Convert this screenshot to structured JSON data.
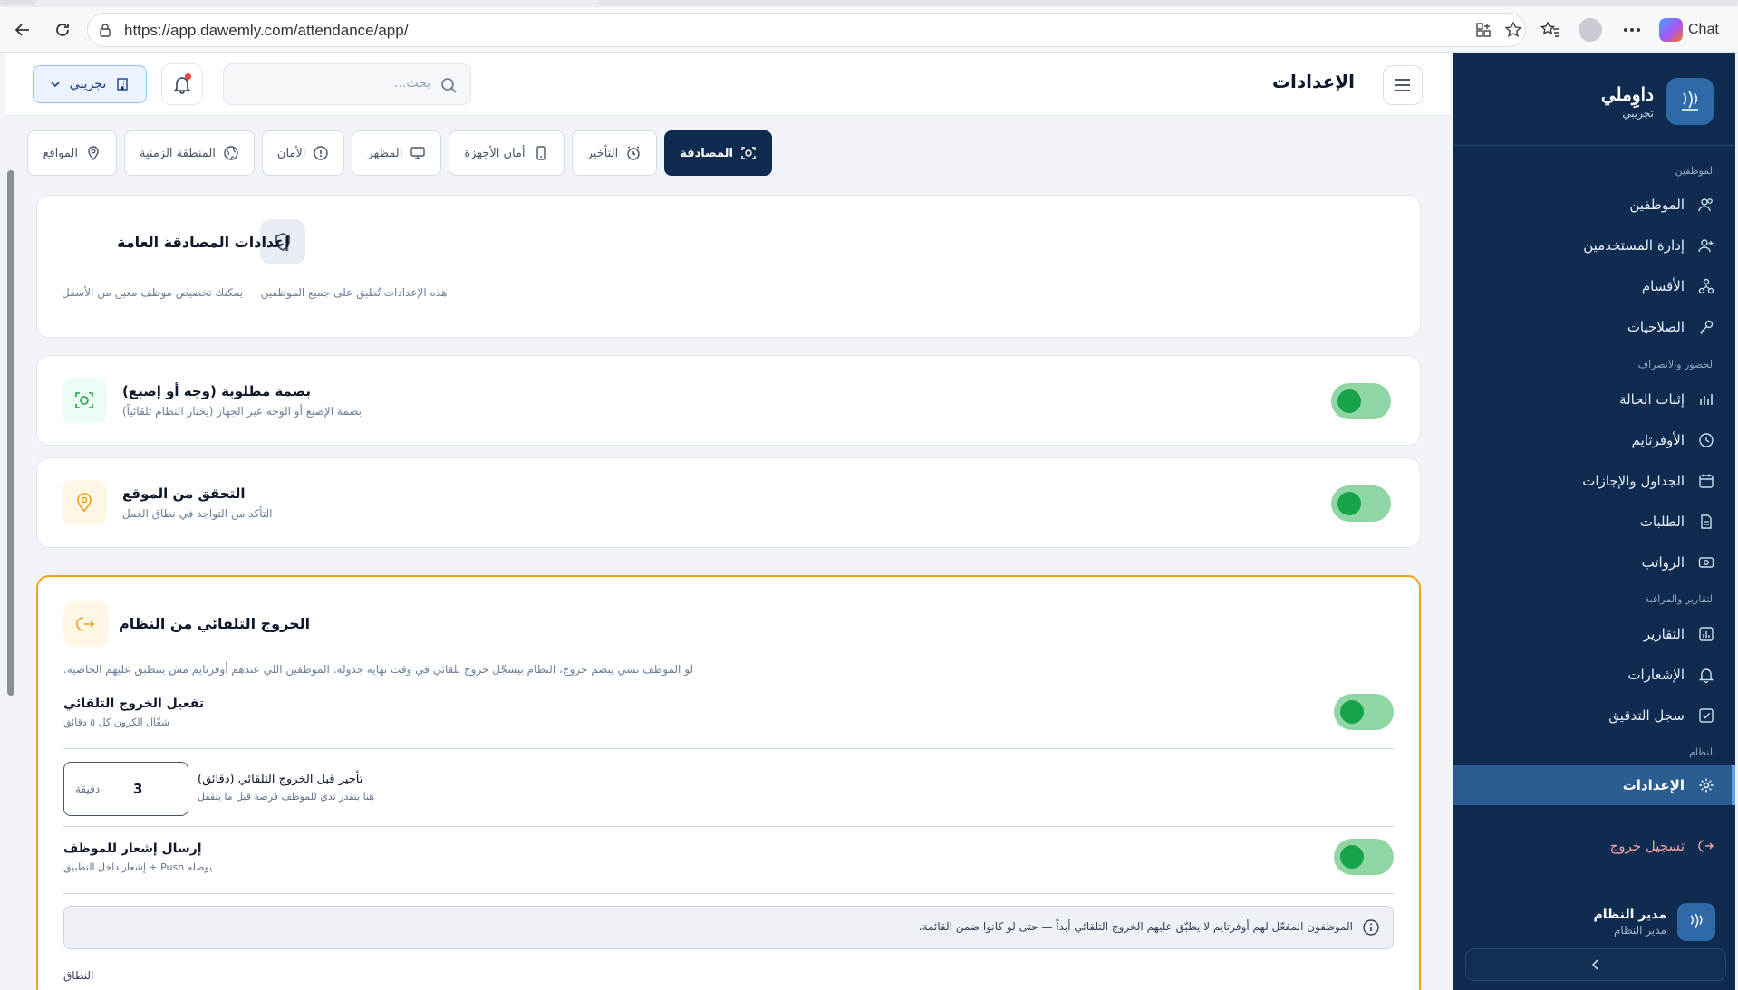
{
  "browser": {
    "url": "https://app.dawemly.com/attendance/app/",
    "chat_label": "Chat"
  },
  "header": {
    "title": "الإعدادات",
    "search_placeholder": "بحث...",
    "company_label": "تجريبي"
  },
  "sidebar": {
    "brand_name": "داوِملي",
    "brand_sub": "تجريبي",
    "sections": {
      "employees": "الموظفين",
      "attendance": "الحضور والانصراف",
      "reports": "التقارير والمراقبة",
      "system": "النظام"
    },
    "items": {
      "employees": "الموظفين",
      "users": "إدارة المستخدمين",
      "departments": "الأقسام",
      "permissions": "الصلاحيات",
      "checkin": "إثبات الحالة",
      "overtime": "الأوفرتايم",
      "schedules": "الجداول والإجازات",
      "requests": "الطلبات",
      "payroll": "الرواتب",
      "reports": "التقارير",
      "notifications": "الإشعارات",
      "audit": "سجل التدقيق",
      "settings": "الإعدادات",
      "logout": "تسجيل خروج"
    },
    "user": {
      "name": "مدير النظام",
      "role": "مدير النظام"
    }
  },
  "tabs": [
    "المصادقة",
    "التأخير",
    "أمان الأجهزة",
    "المظهر",
    "الأمان",
    "المنطقة الزمنية",
    "المواقع"
  ],
  "general_card": {
    "title": "إعدادات المصادقة العامة",
    "desc": "هذه الإعدادات تُطبق على جميع الموظفين — يمكنك تخصيص موظف معين من الأسفل"
  },
  "biometric_card": {
    "title": "بصمة مطلوبة (وجه أو إصبع)",
    "desc": "بصمة الإصبع أو الوجه عبر الجهاز (يختار النظام تلقائياً)",
    "enabled": true
  },
  "location_card": {
    "title": "التحقق من الموقع",
    "desc": "التأكد من التواجد في نطاق العمل",
    "enabled": true
  },
  "autologout_card": {
    "title": "الخروج التلقائي من النظام",
    "desc": "لو الموظف نسي يبصم خروج، النظام بيسجّل خروج تلقائي في وقت نهاية جدوله. الموظفين اللي عندهم أوفرتايم مش بتتطبق عليهم الخاصية.",
    "enable_title": "تفعيل الخروج التلقائي",
    "enable_desc": "شغّال الكرون كل ٥ دقائق",
    "enable_on": true,
    "delay_title": "تأخير قبل الخروج التلقائي (دقائق)",
    "delay_desc": "هنا بتقدر تدي للموظف فرصة قبل ما يتقفل",
    "delay_value": "3",
    "delay_unit": "دقيقة",
    "notify_title": "إرسال إشعار للموظف",
    "notify_desc": "يوصله Push + إشعار داخل التطبيق",
    "notify_on": true,
    "note": "الموظفون المفعّل لهم أوفرتايم لا يطبّق عليهم الخروج التلقائي أبداً — حتى لو كانوا ضمن القائمة.",
    "scope_label": "النطاق"
  },
  "colors": {
    "sidebar_bg": "#0f2b4f",
    "accent": "#0f2b4f",
    "toggle_on": "#16a34a",
    "warning_border": "#f0a21a"
  }
}
